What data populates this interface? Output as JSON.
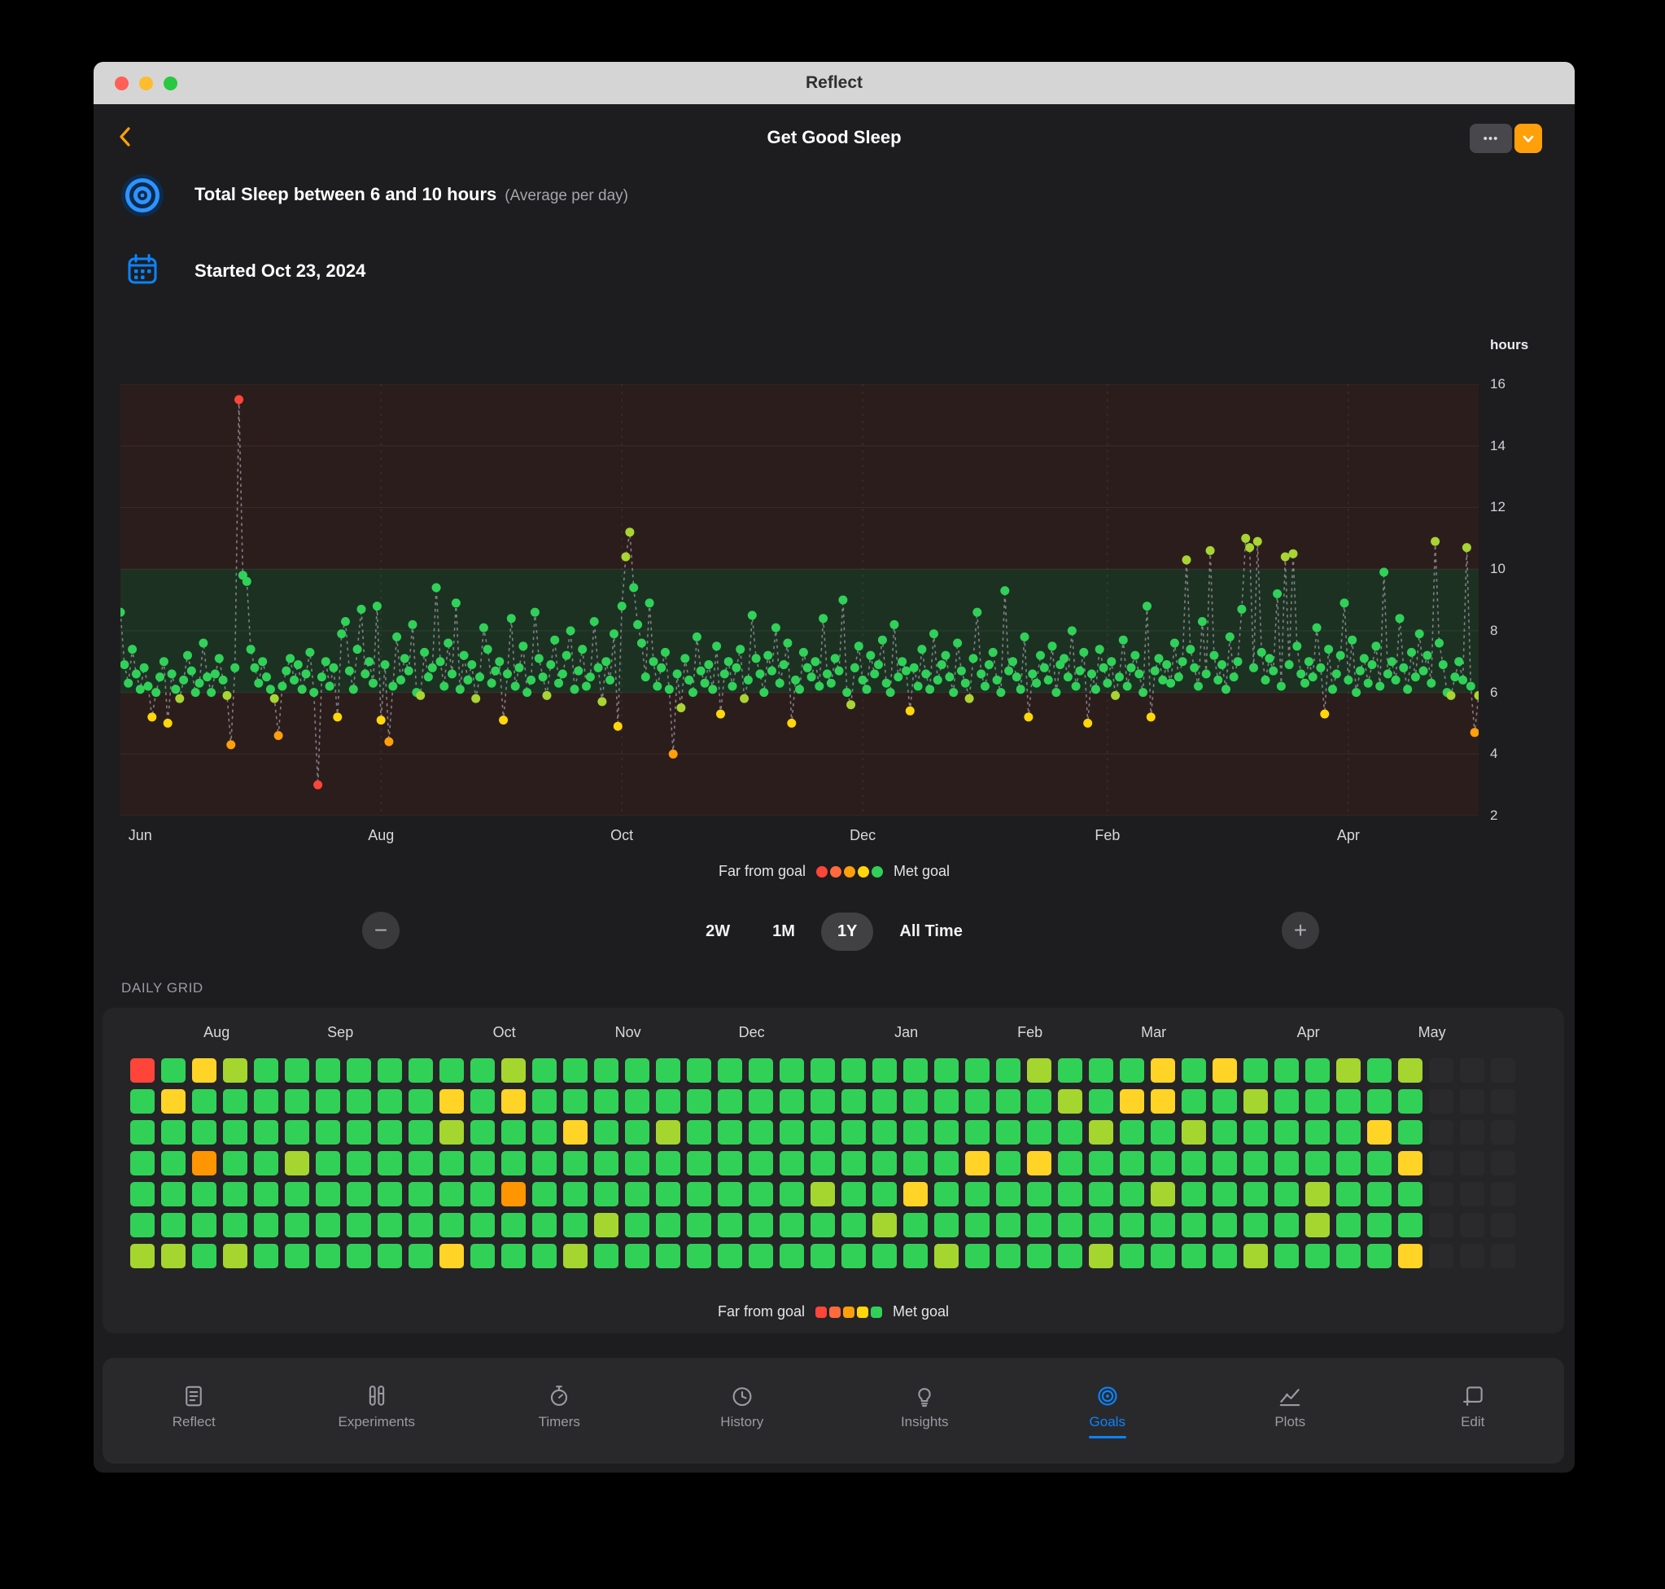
{
  "window": {
    "title": "Reflect"
  },
  "header": {
    "title": "Get Good Sleep",
    "more_label": "•••"
  },
  "goal": {
    "title": "Total Sleep between 6 and 10 hours",
    "subtitle": "(Average  per day)",
    "started": "Started Oct 23, 2024"
  },
  "chart_data": {
    "type": "scatter",
    "unit_label": "hours",
    "ylim": [
      2,
      16
    ],
    "y_ticks": [
      16,
      14,
      12,
      10,
      8,
      6,
      4,
      2
    ],
    "goal_range": [
      6,
      10
    ],
    "days_total": 345,
    "x_months": [
      {
        "label": "Jun",
        "day": 5
      },
      {
        "label": "Aug",
        "day": 66
      },
      {
        "label": "Oct",
        "day": 127
      },
      {
        "label": "Dec",
        "day": 188
      },
      {
        "label": "Feb",
        "day": 250
      },
      {
        "label": "Apr",
        "day": 311
      }
    ],
    "colors": {
      "outside_band": "#2c1d1d",
      "goal_band": "#1d3123"
    },
    "point_colors": {
      "in_goal": "#30d158",
      "near": "#a8d532",
      "off": "#ffd60a",
      "far": "#ff9f0a",
      "very_far": "#ff453a"
    },
    "values": [
      8.6,
      6.9,
      6.3,
      7.4,
      6.6,
      6.1,
      6.8,
      6.2,
      5.2,
      6.0,
      6.5,
      7.0,
      5.0,
      6.6,
      6.1,
      5.8,
      6.4,
      7.2,
      6.7,
      6.0,
      6.3,
      7.6,
      6.5,
      6.0,
      6.6,
      7.1,
      6.4,
      5.9,
      4.3,
      6.8,
      15.5,
      9.8,
      9.6,
      7.4,
      6.8,
      6.3,
      7.0,
      6.5,
      6.1,
      5.8,
      4.6,
      6.2,
      6.7,
      7.1,
      6.4,
      6.9,
      6.1,
      6.6,
      7.3,
      6.0,
      3.0,
      6.5,
      7.0,
      6.2,
      6.8,
      5.2,
      7.9,
      8.3,
      6.7,
      6.1,
      7.4,
      8.7,
      6.6,
      7.0,
      6.3,
      8.8,
      5.1,
      6.9,
      4.4,
      6.2,
      7.8,
      6.4,
      7.1,
      6.7,
      8.2,
      6.0,
      5.9,
      7.3,
      6.5,
      6.8,
      9.4,
      7.0,
      6.2,
      7.6,
      6.6,
      8.9,
      6.1,
      7.2,
      6.4,
      6.9,
      5.8,
      6.5,
      8.1,
      7.4,
      6.3,
      6.7,
      7.0,
      5.1,
      6.6,
      8.4,
      6.2,
      6.8,
      7.5,
      6.0,
      6.4,
      8.6,
      7.1,
      6.5,
      5.9,
      6.9,
      7.7,
      6.3,
      6.6,
      7.2,
      8.0,
      6.1,
      6.7,
      7.4,
      6.2,
      6.5,
      8.3,
      6.8,
      5.7,
      7.0,
      6.4,
      7.9,
      4.9,
      8.8,
      10.4,
      11.2,
      9.4,
      8.2,
      7.6,
      6.5,
      8.9,
      7.0,
      6.2,
      6.8,
      7.3,
      6.1,
      4.0,
      6.6,
      5.5,
      7.1,
      6.4,
      6.0,
      7.8,
      6.7,
      6.3,
      6.9,
      6.1,
      7.5,
      5.3,
      6.6,
      7.0,
      6.2,
      6.8,
      7.4,
      5.8,
      6.4,
      8.5,
      7.1,
      6.6,
      6.0,
      7.2,
      6.7,
      8.1,
      6.3,
      6.9,
      7.6,
      5.0,
      6.4,
      6.1,
      7.3,
      6.8,
      6.5,
      7.0,
      6.2,
      8.4,
      6.6,
      6.3,
      7.1,
      6.7,
      9.0,
      6.0,
      5.6,
      6.8,
      7.5,
      6.4,
      6.1,
      7.2,
      6.6,
      6.9,
      7.7,
      6.3,
      6.0,
      8.2,
      6.5,
      7.0,
      6.7,
      5.4,
      6.8,
      6.2,
      7.4,
      6.6,
      6.1,
      7.9,
      6.4,
      6.9,
      7.2,
      6.5,
      6.0,
      7.6,
      6.7,
      6.3,
      5.8,
      7.1,
      8.6,
      6.6,
      6.2,
      6.9,
      7.3,
      6.4,
      6.0,
      9.3,
      6.7,
      7.0,
      6.5,
      6.1,
      7.8,
      5.2,
      6.6,
      6.3,
      7.2,
      6.8,
      6.4,
      7.5,
      6.0,
      6.9,
      7.1,
      6.5,
      8.0,
      6.2,
      6.7,
      7.3,
      5.0,
      6.6,
      6.1,
      7.4,
      6.8,
      6.3,
      7.0,
      5.9,
      6.5,
      7.7,
      6.2,
      6.8,
      7.2,
      6.6,
      6.0,
      8.8,
      5.2,
      6.7,
      7.1,
      6.4,
      6.9,
      6.3,
      7.6,
      6.5,
      7.0,
      10.3,
      7.4,
      6.8,
      6.2,
      8.3,
      6.6,
      10.6,
      7.2,
      6.4,
      6.9,
      6.1,
      7.8,
      6.5,
      7.0,
      8.7,
      11.0,
      10.7,
      6.8,
      10.9,
      7.3,
      6.4,
      7.1,
      6.7,
      9.2,
      6.2,
      10.4,
      6.9,
      10.5,
      7.5,
      6.6,
      6.3,
      7.0,
      6.5,
      8.1,
      6.8,
      5.3,
      7.4,
      6.1,
      6.6,
      7.2,
      8.9,
      6.4,
      7.7,
      6.0,
      6.7,
      7.1,
      6.3,
      6.9,
      7.5,
      6.2,
      9.9,
      6.6,
      7.0,
      6.4,
      8.4,
      6.8,
      6.1,
      7.3,
      6.5,
      7.9,
      6.7,
      7.2,
      6.3,
      10.9,
      7.6,
      6.9,
      6.0,
      5.9,
      6.5,
      7.0,
      6.4,
      10.7,
      6.2,
      4.7,
      5.9
    ]
  },
  "legend": {
    "far": "Far from goal",
    "met": "Met goal",
    "colors": [
      "#ff453a",
      "#ff6a3d",
      "#ff9f0a",
      "#ffd60a",
      "#30d158"
    ]
  },
  "controls": {
    "zoom_out": "−",
    "zoom_in": "+",
    "ranges": [
      "2W",
      "1M",
      "1Y",
      "All Time"
    ],
    "selected": "1Y"
  },
  "daily_grid": {
    "section_label": "DAILY GRID",
    "months": [
      {
        "label": "Aug",
        "col": 2.4
      },
      {
        "label": "Sep",
        "col": 6.4
      },
      {
        "label": "Oct",
        "col": 11.7
      },
      {
        "label": "Nov",
        "col": 15.7
      },
      {
        "label": "Dec",
        "col": 19.7
      },
      {
        "label": "Jan",
        "col": 24.7
      },
      {
        "label": "Feb",
        "col": 28.7
      },
      {
        "label": "Mar",
        "col": 32.7
      },
      {
        "label": "Apr",
        "col": 37.7
      },
      {
        "label": "May",
        "col": 41.7
      }
    ],
    "palette": {
      "g": "#31d158",
      "l": "#a5d62f",
      "y": "#ffd426",
      "o": "#ff9500",
      "r": "#ff453a",
      "e": "#2a2a2d"
    },
    "rows": [
      "rgylgggggggglgggggggggggggggglgggygyggglgleee",
      "gyggggggggygyggggggggggggggggglgyygglgggggeee",
      "gggggggggglgggygglggggggggggggglgglgggggygeee",
      "ggogglgggggggggggggggggggggygygggggggggggyeee",
      "ggggggggggggoggggggggglggyggggggglgggglgggeee",
      "ggggggggggggggglgggggggglggggggggdgggglgggeee",
      "llglggggggyggglggggggggggglgggglgggglggggyeee"
    ]
  },
  "tabbar": {
    "tabs": [
      {
        "label": "Reflect",
        "icon": "journal-icon",
        "active": false
      },
      {
        "label": "Experiments",
        "icon": "test-tubes-icon",
        "active": false
      },
      {
        "label": "Timers",
        "icon": "stopwatch-icon",
        "active": false
      },
      {
        "label": "History",
        "icon": "clock-icon",
        "active": false
      },
      {
        "label": "Insights",
        "icon": "lightbulb-icon",
        "active": false
      },
      {
        "label": "Goals",
        "icon": "target-icon",
        "active": true
      },
      {
        "label": "Plots",
        "icon": "line-chart-icon",
        "active": false
      },
      {
        "label": "Edit",
        "icon": "edit-box-icon",
        "active": false
      }
    ]
  }
}
